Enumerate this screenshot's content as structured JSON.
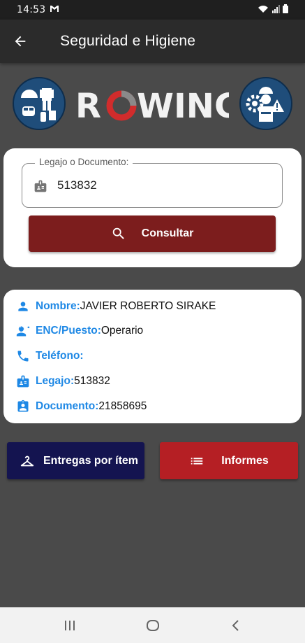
{
  "status_bar": {
    "time": "14:53"
  },
  "app_bar": {
    "title": "Seguridad e Higiene"
  },
  "logo": {
    "text": "ROWING"
  },
  "search": {
    "label": "Legajo o Documento:",
    "value": "513832",
    "button_label": "Consultar"
  },
  "employee": {
    "rows": [
      {
        "key": "Nombre:",
        "value": "JAVIER ROBERTO SIRAKE",
        "icon": "person-icon"
      },
      {
        "key": "ENC/Puesto:",
        "value": "Operario",
        "icon": "engineer-icon"
      },
      {
        "key": "Teléfono:",
        "value": "",
        "icon": "phone-icon"
      },
      {
        "key": "Legajo:",
        "value": "513832",
        "icon": "badge-icon"
      },
      {
        "key": "Documento:",
        "value": "21858695",
        "icon": "id-card-icon"
      }
    ]
  },
  "actions": {
    "entregas_label": "Entregas por ítem",
    "informes_label": "Informes"
  },
  "colors": {
    "accent": "#1e88e5",
    "primary_dark_red": "#7c1d1d",
    "navy": "#141450",
    "red": "#b51f24",
    "background": "#4a4a4a"
  }
}
